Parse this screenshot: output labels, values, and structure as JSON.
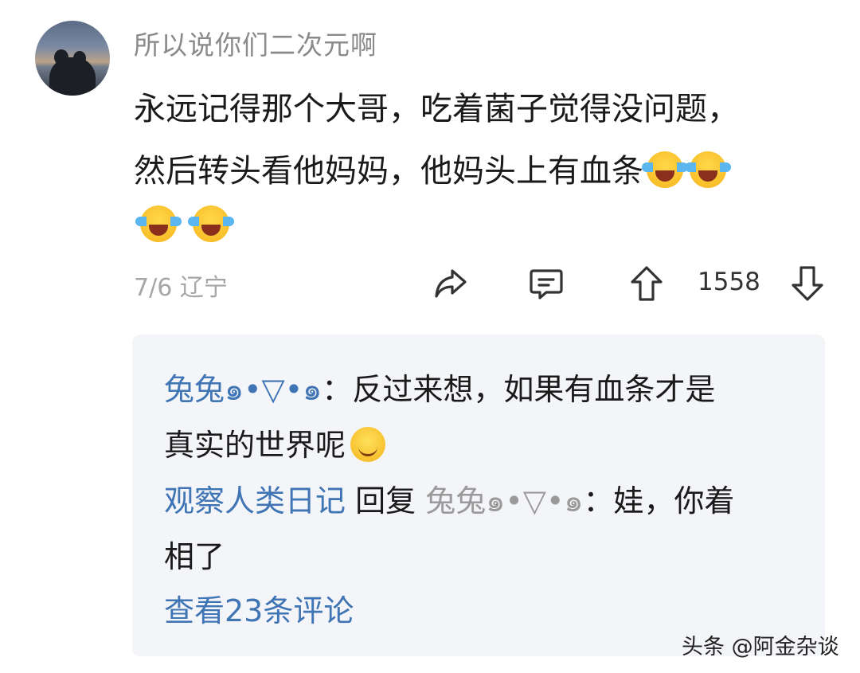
{
  "comment": {
    "username": "所以说你们二次元啊",
    "text_line1": "永远记得那个大哥，吃着菌子觉得没问题，",
    "text_line2": "然后转头看他妈妈，他妈头上有血条",
    "emoji": "laugh-cry-emoji",
    "date": "7/6",
    "location": "辽宁",
    "like_count": "1558"
  },
  "replies": {
    "reply1": {
      "author": "兔兔๑•▽•๑",
      "separator": "：",
      "text_line1": "反过来想，如果有血条才是",
      "text_line2": "真实的世界呢"
    },
    "reply2": {
      "author": "观察人类日记",
      "reply_word": "回复",
      "target": "兔兔๑•▽•๑",
      "separator": "：",
      "text_line1": "娃，你着",
      "text_line2": "相了"
    },
    "view_more": "查看23条评论"
  },
  "watermark": "头条 @阿金杂谈",
  "colors": {
    "link_blue": "#3f74b5",
    "meta_grey": "#a6a6a6",
    "reply_bg": "#f4f5f8"
  },
  "icons": [
    "share-icon",
    "comment-icon",
    "upvote-icon",
    "downvote-icon"
  ]
}
